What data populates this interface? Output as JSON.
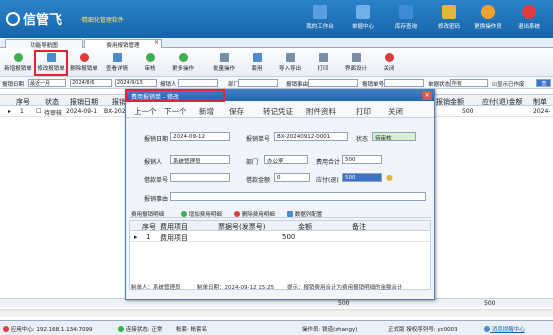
{
  "app": {
    "logo": "信管飞",
    "subtitle": "·精细化管理软件"
  },
  "top_buttons": [
    "我的工作台",
    "单据中心",
    "库存查询",
    "修改密码",
    "更换操作员",
    "退出系统"
  ],
  "tabs": [
    "功能导航图",
    "费用报销管理"
  ],
  "toolbar": [
    "新增报销单",
    "修改报销单",
    "删除报销单",
    "查看详情",
    "审核",
    "更多操作",
    "批量操作",
    "套用",
    "导入导出",
    "打印",
    "界面设计",
    "关闭"
  ],
  "filter": {
    "date_label": "报销日期",
    "date_range": "最近一月",
    "date_from": "2024/8/6",
    "date_to": "2024/9/13",
    "person_label": "报销人",
    "dept_label": "部门",
    "reason_label": "报销事由",
    "bill_label": "报销单号",
    "status_label": "单据状态",
    "status_value": "所有",
    "show_finished": "显示已作废",
    "query": "查"
  },
  "grid": {
    "headers": [
      "序号",
      "状态",
      "报销日期",
      "报销单号",
      "报销金额",
      "应付(退)金额",
      "制单"
    ],
    "rows": [
      {
        "no": "1",
        "status": "待审核",
        "date": "2024-09-1",
        "bill": "BX-2024",
        "amount": "500",
        "payable": "",
        "maker": "2024-"
      }
    ],
    "total_amount": "500",
    "total_payable": "500"
  },
  "dialog": {
    "title": "费用报销单 - 修改",
    "toolbar": [
      "上一个",
      "下一个",
      "新增",
      "保存",
      "转记凭证",
      "附件资料",
      "打印",
      "关闭"
    ],
    "date_label": "报销日期",
    "date": "2024-09-12",
    "bill_label": "报销单号",
    "bill": "BX-20240912-0001",
    "status_label": "状态",
    "status": "待审核",
    "person_label": "报销人",
    "person": "系统管理员",
    "dept_label": "部门",
    "dept": "办公室",
    "total_label": "费用合计",
    "total": "500",
    "borrow_no_label": "借款单号",
    "borrow_amt_label": "借款金额",
    "borrow_amt": "0",
    "payable_label": "应付(退)",
    "payable": "500",
    "reason_label": "报销事由",
    "sub_tabs": [
      "费用报销明细",
      "增加费用明细",
      "删除费用明细",
      "数据列配置"
    ],
    "detail_headers": [
      "序号",
      "费用项目",
      "票据号(发票号)",
      "金额",
      "备注"
    ],
    "detail_rows": [
      {
        "no": "1",
        "item": "费用项目",
        "invoice": "",
        "amount": "500",
        "note": ""
      }
    ],
    "footer": {
      "maker": "制单人：系统管理员",
      "made": "制单日期：2024-09-12 15:25",
      "tip": "提示：报销费用合计为费用报销明细的金额合计"
    }
  },
  "status_bar": {
    "server": "应用中心: 192.168.1.134:7099",
    "conn": "连接状态: 正常",
    "user": "帐套: 帐套名",
    "op": "操作员: 铁道(zhangy)",
    "ver": "正式版 授权序列号: yc0003",
    "msg": "消息提醒中心"
  },
  "colors": {
    "header": "#1765ab",
    "highlight": "#e0262e"
  }
}
